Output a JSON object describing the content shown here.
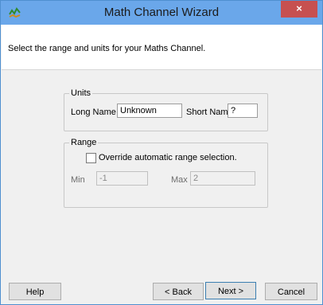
{
  "window": {
    "title": "Math Channel Wizard",
    "close_glyph": "×",
    "app_icon": "wizard-app-icon",
    "titlebar_color": "#6aa7ea",
    "close_color": "#c75050"
  },
  "header": {
    "instruction": "Select the range and units for your Maths Channel."
  },
  "units": {
    "legend": "Units",
    "long_name_label": "Long Name",
    "long_name_value": "Unknown",
    "short_name_label": "Short Name",
    "short_name_value": "?"
  },
  "range": {
    "legend": "Range",
    "override_label": "Override automatic range selection.",
    "override_checked": false,
    "min_label": "Min",
    "min_value": "-1",
    "max_label": "Max",
    "max_value": "2"
  },
  "buttons": {
    "help": "Help",
    "back": "< Back",
    "next": "Next >",
    "cancel": "Cancel"
  }
}
